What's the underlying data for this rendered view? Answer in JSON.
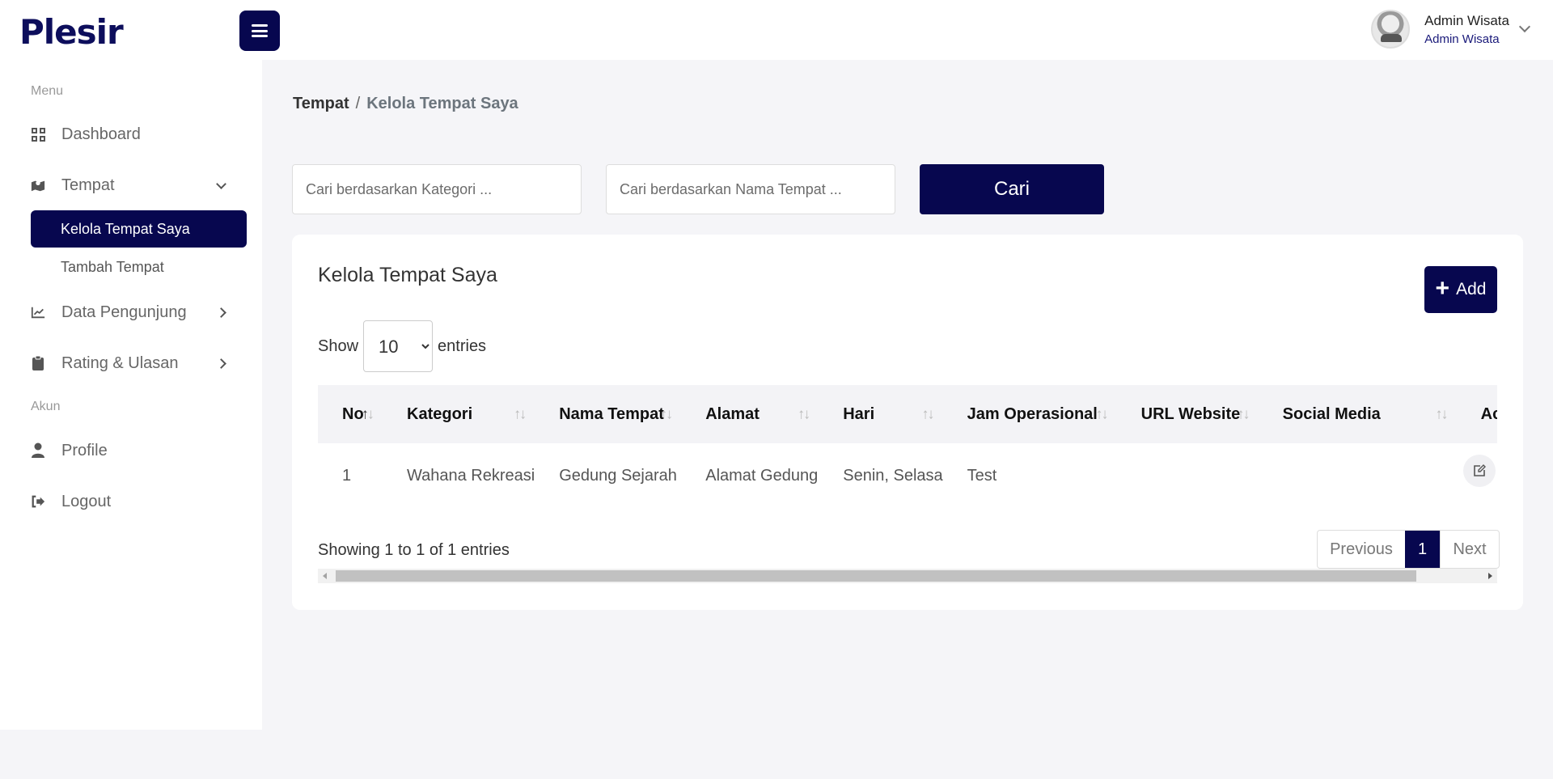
{
  "header": {
    "logo_text": "Plesir",
    "user_name": "Admin Wisata",
    "user_role": "Admin Wisata"
  },
  "sidebar": {
    "menu_label": "Menu",
    "account_label": "Akun",
    "items": [
      {
        "label": "Dashboard",
        "icon": "dashboard-icon"
      },
      {
        "label": "Tempat",
        "icon": "map-icon",
        "expanded": true,
        "children": [
          {
            "label": "Kelola Tempat Saya",
            "active": true
          },
          {
            "label": "Tambah Tempat",
            "active": false
          }
        ]
      },
      {
        "label": "Data Pengunjung",
        "icon": "chart-icon"
      },
      {
        "label": "Rating & Ulasan",
        "icon": "clipboard-icon"
      }
    ],
    "account_items": [
      {
        "label": "Profile",
        "icon": "user-icon"
      },
      {
        "label": "Logout",
        "icon": "logout-icon"
      }
    ]
  },
  "breadcrumb": {
    "parent": "Tempat",
    "separator": "/",
    "current": "Kelola Tempat Saya"
  },
  "search": {
    "kategori_placeholder": "Cari berdasarkan Kategori ...",
    "nama_placeholder": "Cari berdasarkan Nama Tempat ...",
    "button_label": "Cari"
  },
  "card": {
    "title": "Kelola Tempat Saya",
    "add_label": "Add",
    "show_label": "Show",
    "entries_value": "10",
    "entries_label": "entries",
    "columns": [
      "No",
      "Kategori",
      "Nama Tempat",
      "Alamat",
      "Hari",
      "Jam Operasional",
      "URL Website",
      "Social Media",
      "Ac"
    ],
    "rows": [
      {
        "no": "1",
        "kategori": "Wahana Rekreasi",
        "nama": "Gedung Sejarah",
        "alamat": "Alamat Gedung",
        "hari": "Senin, Selasa",
        "jam": "Test",
        "url": "",
        "social": ""
      }
    ],
    "showing_text": "Showing 1 to 1 of 1 entries",
    "pagination": {
      "previous": "Previous",
      "page": "1",
      "next": "Next"
    }
  },
  "colors": {
    "primary": "#07074f",
    "background": "#f5f5f8"
  }
}
